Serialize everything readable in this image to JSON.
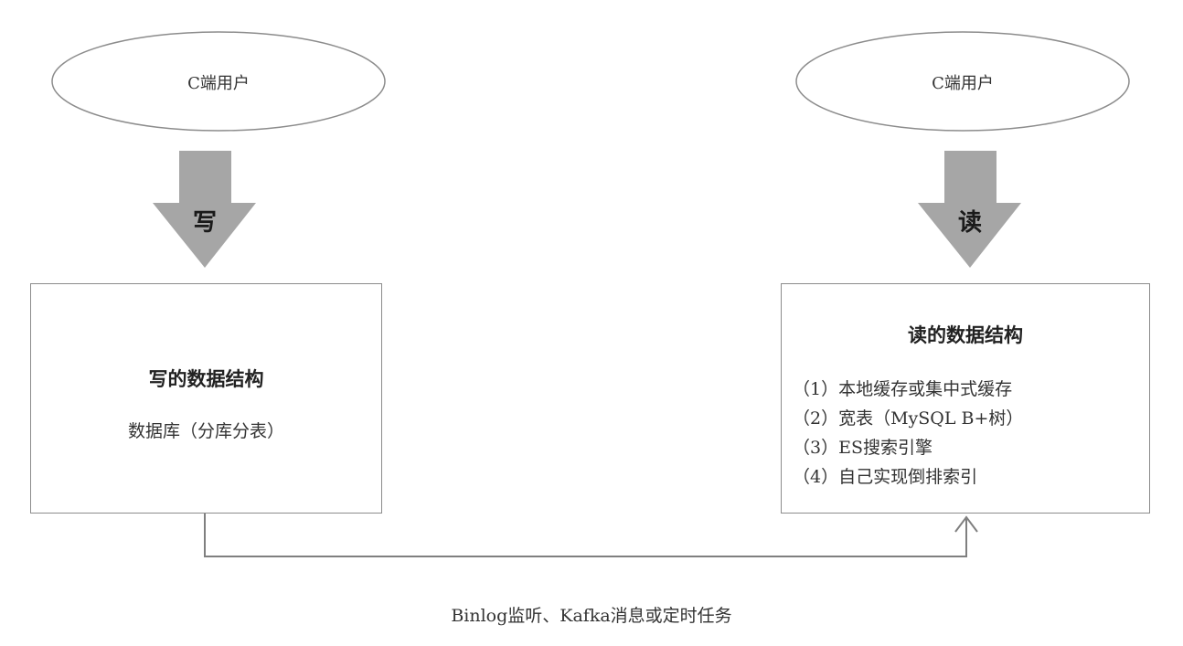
{
  "diagram": {
    "left": {
      "user_label": "C端用户",
      "action_label": "写",
      "box_title": "写的数据结构",
      "box_lines": [
        "数据库（分库分表）"
      ]
    },
    "right": {
      "user_label": "C端用户",
      "action_label": "读",
      "box_title": "读的数据结构",
      "box_lines": [
        "（1）本地缓存或集中式缓存",
        "（2）宽表（MySQL B+树）",
        "（3）ES搜索引擎",
        "（4）自己实现倒排索引"
      ]
    },
    "sync_label": "Binlog监听、Kafka消息或定时任务",
    "colors": {
      "arrow_fill": "#a6a6a6",
      "border": "#8c8c8c",
      "connector": "#7f7f7f"
    }
  }
}
